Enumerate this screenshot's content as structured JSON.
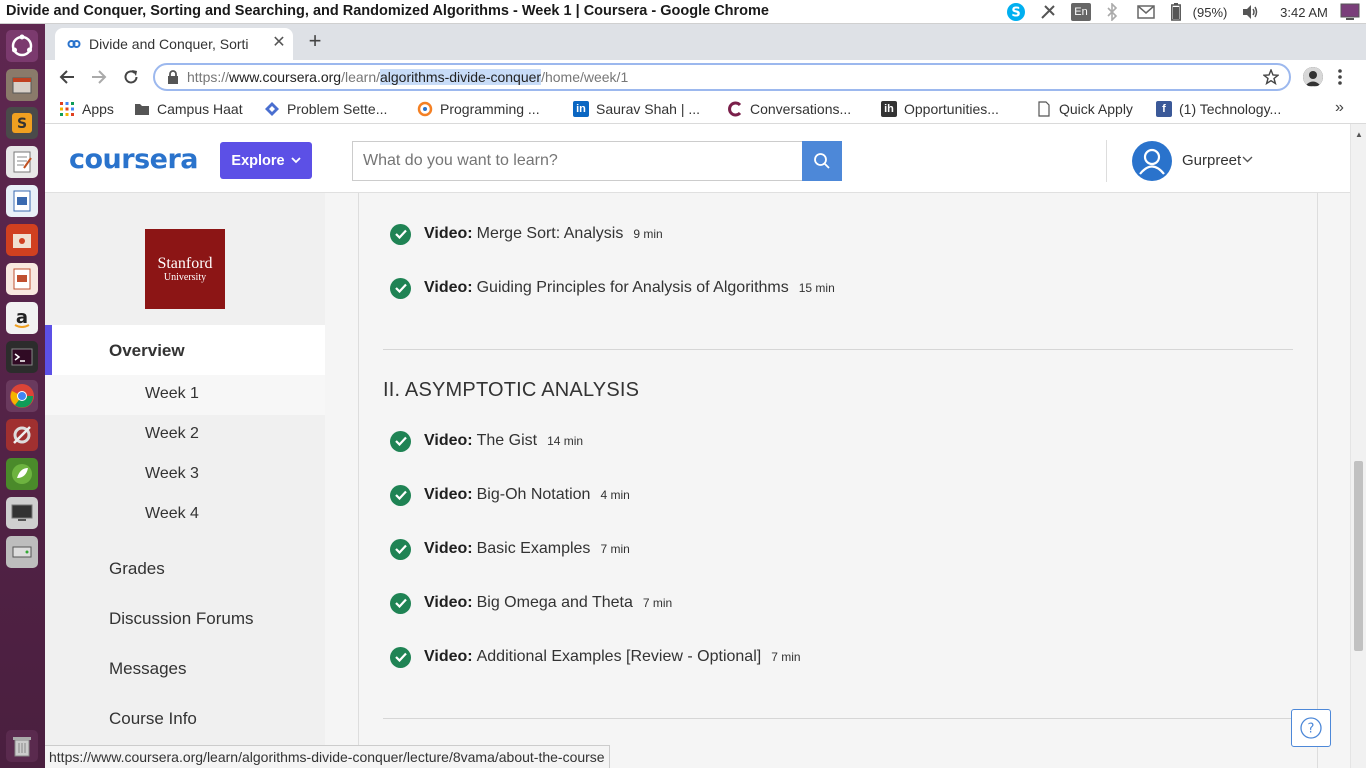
{
  "os_panel": {
    "window_title": "Divide and Conquer, Sorting and Searching, and Randomized Algorithms - Week 1 | Coursera - Google Chrome",
    "keyboard_layout": "En",
    "battery": "(95%)",
    "time": "3:42 AM"
  },
  "launcher": {
    "icons": [
      "ubuntu-dash-icon",
      "files-icon",
      "sublime-text-icon",
      "text-editor-icon",
      "libreoffice-writer-icon",
      "file-manager-icon",
      "libreoffice-impress-icon",
      "amazon-icon",
      "terminal-icon",
      "chrome-icon",
      "settings-icon",
      "spring-tool-icon",
      "display-icon",
      "disk-icon",
      "trash-icon"
    ]
  },
  "chrome": {
    "tab_title": "Divide and Conquer, Sorti",
    "url_prefix": "https://",
    "url_domain": "www.coursera.org",
    "url_path1": "/learn/",
    "url_selected": "algorithms-divide-conquer",
    "url_path2": "/home/week/1",
    "bookmarks": [
      {
        "label": "Apps",
        "icon": "apps-grid-icon"
      },
      {
        "label": "Campus Haat",
        "icon": "folder-icon"
      },
      {
        "label": "Problem Sette...",
        "icon": "diamond-icon"
      },
      {
        "label": "Programming ...",
        "icon": "stackoverflow-icon"
      },
      {
        "label": "Saurav Shah | ...",
        "icon": "linkedin-icon"
      },
      {
        "label": "Conversations...",
        "icon": "chat-icon"
      },
      {
        "label": "Opportunities...",
        "icon": "ih-icon"
      },
      {
        "label": "Quick Apply",
        "icon": "page-icon"
      },
      {
        "label": "(1) Technology...",
        "icon": "facebook-icon"
      }
    ],
    "status_url": "https://www.coursera.org/learn/algorithms-divide-conquer/lecture/8vama/about-the-course"
  },
  "header": {
    "logo": "coursera",
    "explore_label": "Explore",
    "search_placeholder": "What do you want to learn?",
    "user_name": "Gurpreet"
  },
  "sidebar": {
    "university_line1": "Stanford",
    "university_line2": "University",
    "overview": "Overview",
    "weeks": [
      "Week 1",
      "Week 2",
      "Week 3",
      "Week 4"
    ],
    "items": [
      "Grades",
      "Discussion Forums",
      "Messages",
      "Course Info"
    ]
  },
  "main": {
    "videos_top": [
      {
        "type": "Video:",
        "title": "Merge Sort: Analysis",
        "duration": "9 min"
      },
      {
        "type": "Video:",
        "title": "Guiding Principles for Analysis of Algorithms",
        "duration": "15 min"
      }
    ],
    "section_title": "II. ASYMPTOTIC ANALYSIS",
    "videos_section": [
      {
        "type": "Video:",
        "title": "The Gist",
        "duration": "14 min"
      },
      {
        "type": "Video:",
        "title": "Big-Oh Notation",
        "duration": "4 min"
      },
      {
        "type": "Video:",
        "title": "Basic Examples",
        "duration": "7 min"
      },
      {
        "type": "Video:",
        "title": "Big Omega and Theta",
        "duration": "7 min"
      },
      {
        "type": "Video:",
        "title": "Additional Examples [Review - Optional]",
        "duration": "7 min"
      }
    ]
  },
  "colors": {
    "accent": "#5c50e6",
    "brand": "#2a73cc",
    "completed": "#1f8354",
    "university": "#8c1515",
    "launcher": "#5e2750"
  }
}
